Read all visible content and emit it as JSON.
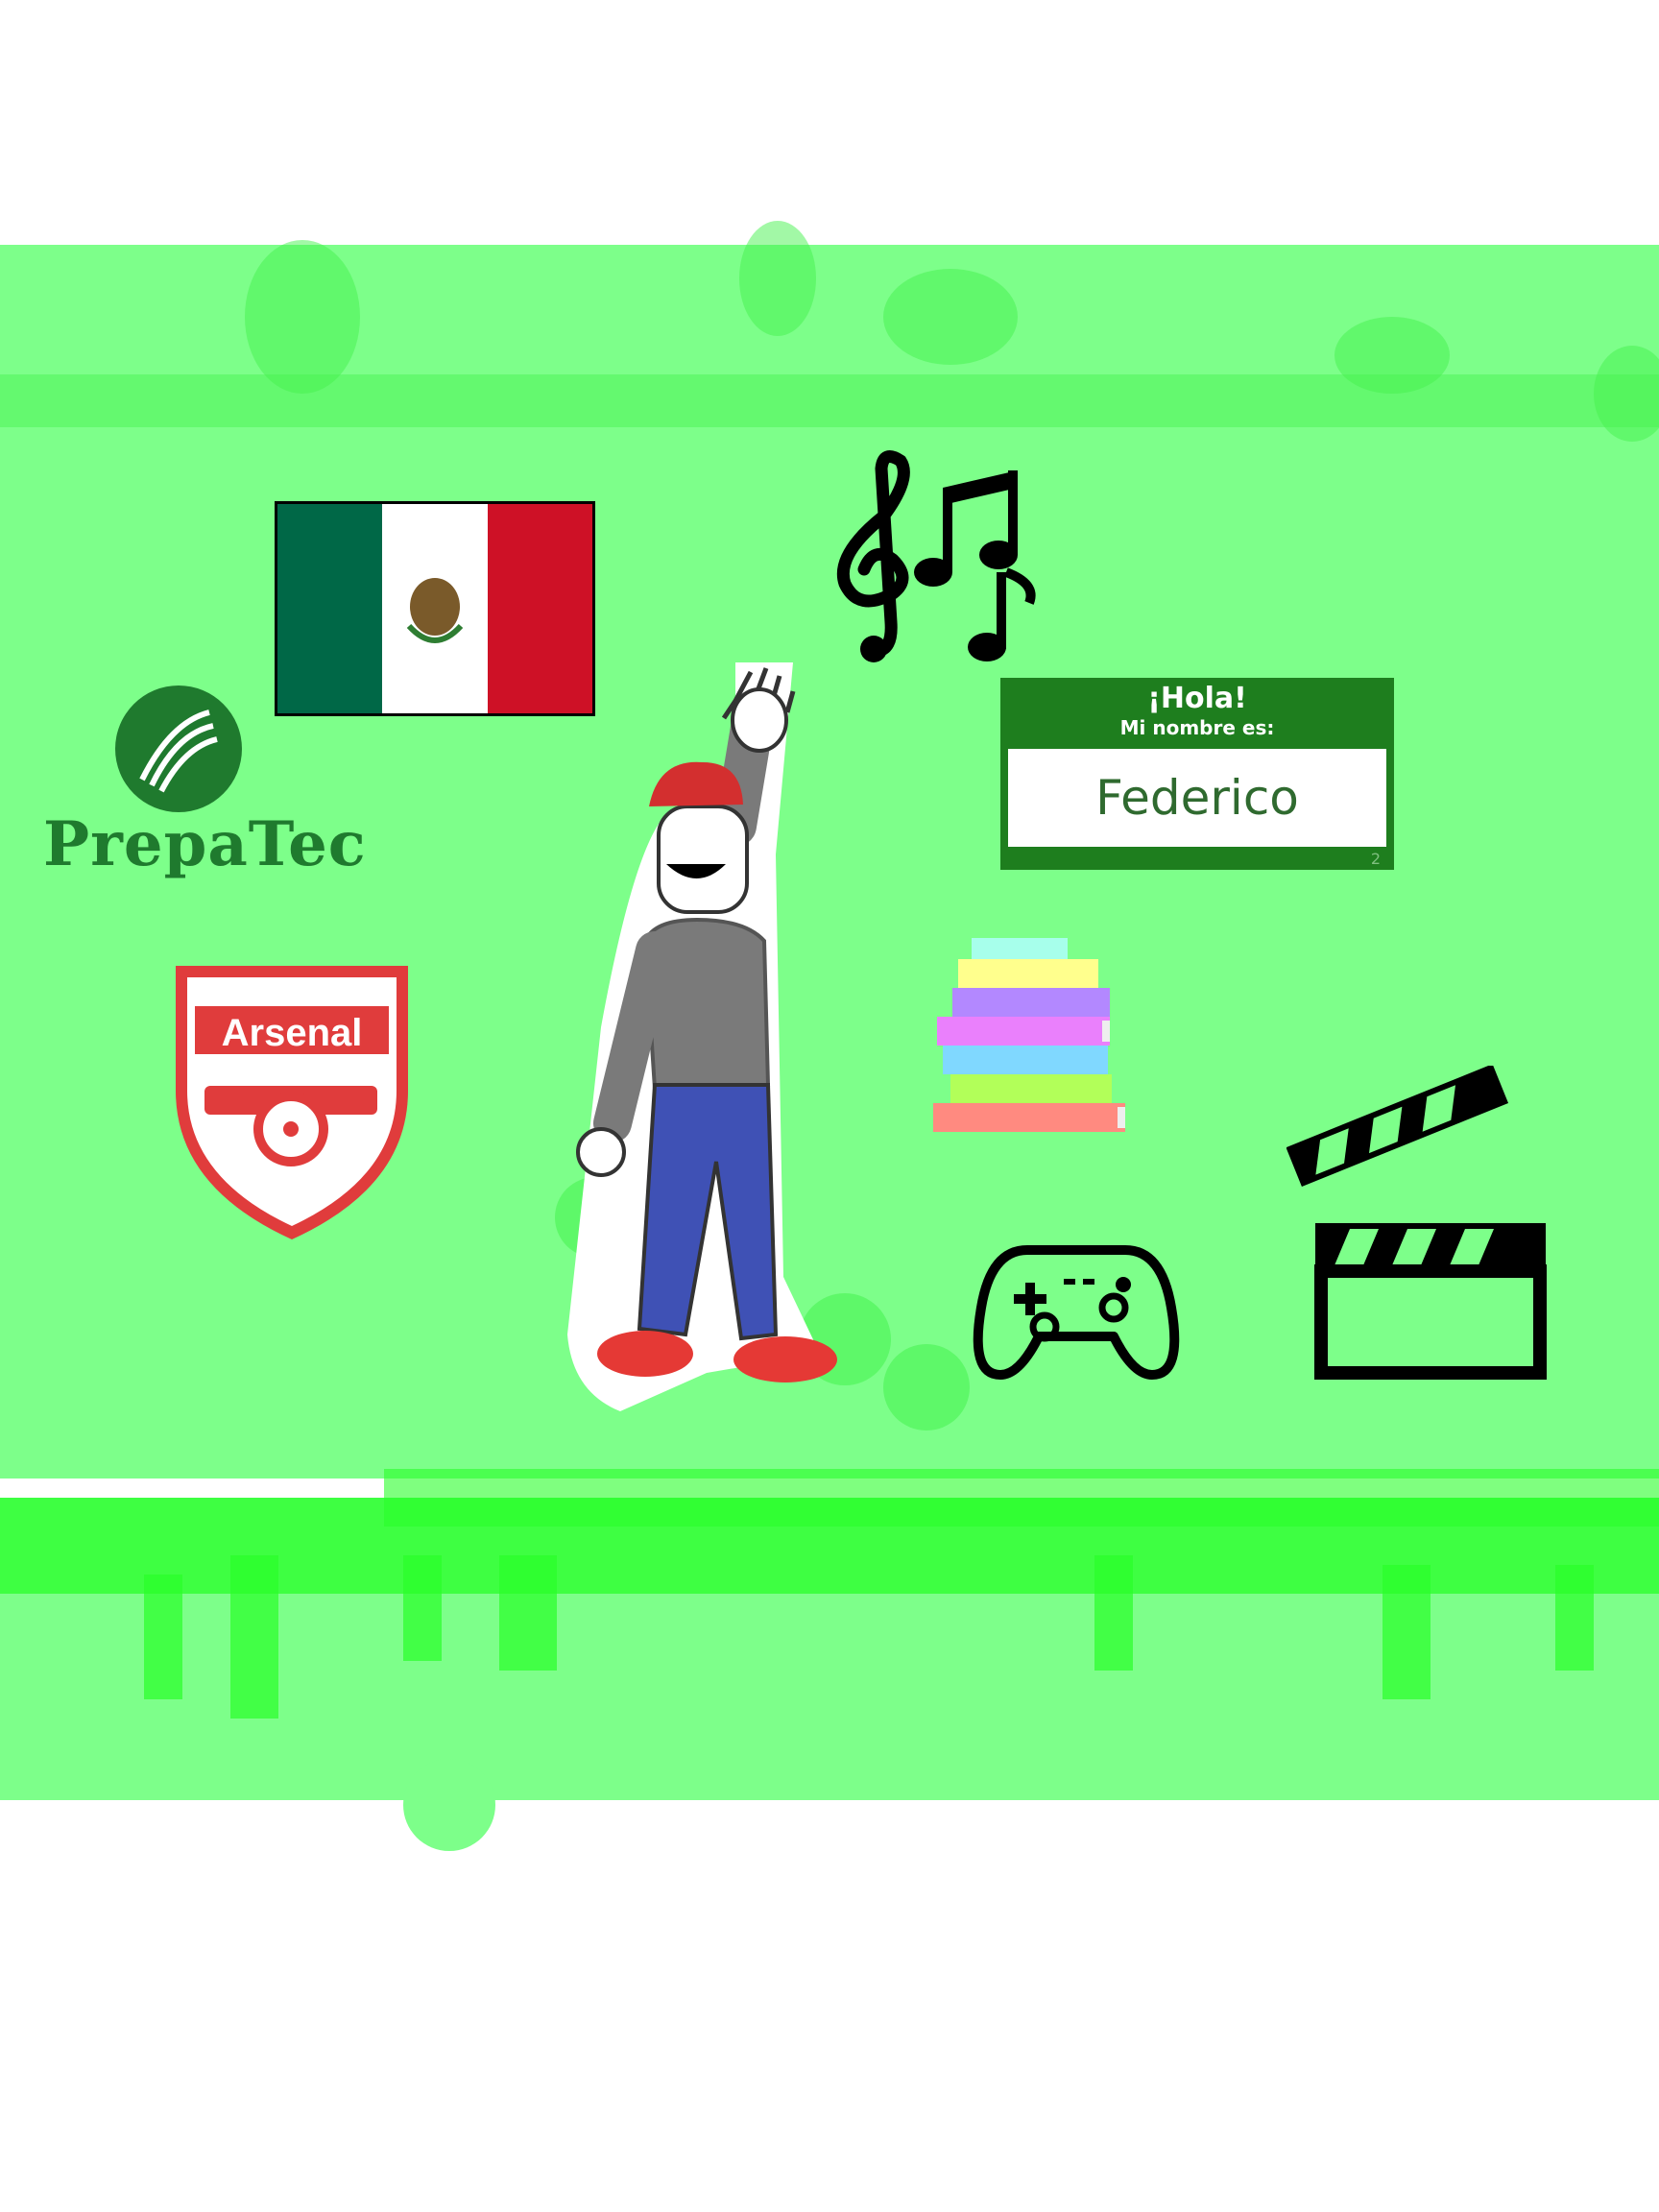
{
  "canvas": {
    "background": "#ffffff",
    "paint_color": "#7dff8a",
    "drip_color": "#2aff2a"
  },
  "prepatec": {
    "wordmark": "PrepaTec",
    "color": "#1f7a2e"
  },
  "name_tag": {
    "greeting": "¡Hola!",
    "subtitle": "Mi nombre es:",
    "name": "Federico",
    "number": "2",
    "color": "#1e7e1e"
  },
  "arsenal": {
    "wordmark": "Arsenal",
    "color": "#e03c3c"
  },
  "flag": {
    "colors": [
      "#006847",
      "#ffffff",
      "#ce1126"
    ]
  },
  "icons": [
    "mexico-flag-icon",
    "prepatec-logo-icon",
    "arsenal-crest-icon",
    "music-notes-icon",
    "books-stack-icon",
    "game-controller-icon",
    "clapperboard-icon",
    "person-waving-icon"
  ]
}
